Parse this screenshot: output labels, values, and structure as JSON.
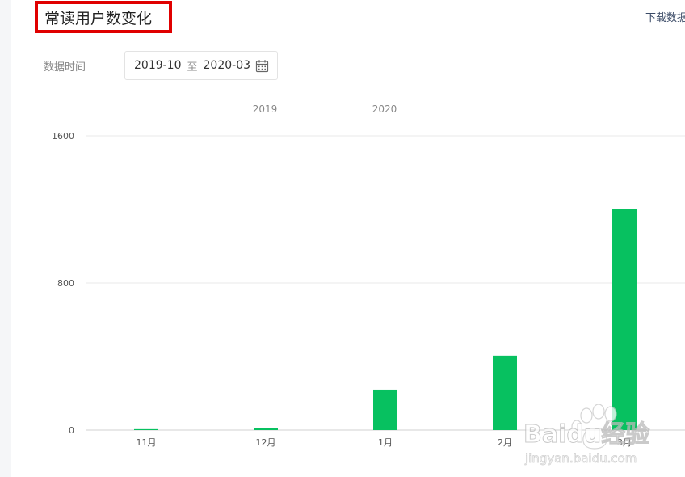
{
  "header": {
    "title": "常读用户数变化",
    "download_label": "下载数据"
  },
  "filter": {
    "label": "数据时间",
    "start": "2019-10",
    "separator": "至",
    "end": "2020-03",
    "icon": "calendar-icon"
  },
  "colors": {
    "bar": "#07c160",
    "grid": "#e8e8e8",
    "title_border": "#e00000"
  },
  "watermark": {
    "brand": "Baidu经验",
    "url": "jingyan.baidu.com"
  },
  "chart_data": {
    "type": "bar",
    "categories": [
      "11月",
      "12月",
      "1月",
      "2月",
      "3月"
    ],
    "values": [
      5,
      12,
      220,
      405,
      1200
    ],
    "year_labels": [
      "2019",
      "2020"
    ],
    "yticks": [
      0,
      800,
      1600
    ],
    "ylim": [
      0,
      1600
    ],
    "title": "",
    "xlabel": "",
    "ylabel": "",
    "grid": true,
    "legend": "none"
  }
}
